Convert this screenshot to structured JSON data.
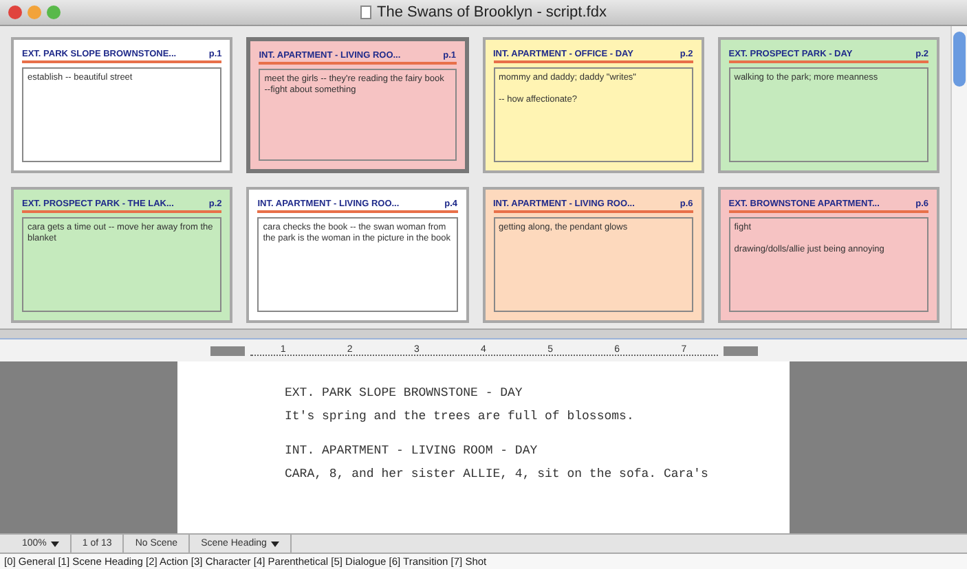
{
  "window": {
    "title": "The Swans of Brooklyn - script.fdx"
  },
  "cards": [
    {
      "heading": "EXT. PARK SLOPE BROWNSTONE...",
      "page": "p.1",
      "notes": "establish -- beautiful street",
      "color": "#ffffff",
      "selected": false
    },
    {
      "heading": "INT. APARTMENT - LIVING ROO...",
      "page": "p.1",
      "notes": "meet the girls -- they're reading the fairy book\n--fight about something",
      "color": "#f6c3c3",
      "selected": true
    },
    {
      "heading": "INT. APARTMENT - OFFICE - DAY",
      "page": "p.2",
      "notes": "mommy and daddy; daddy \"writes\"\n\n-- how affectionate?",
      "color": "#fff4b3",
      "selected": false
    },
    {
      "heading": "EXT. PROSPECT PARK - DAY",
      "page": "p.2",
      "notes": "walking to the park; more meanness",
      "color": "#c5eabd",
      "selected": false
    },
    {
      "heading": "EXT. PROSPECT PARK - THE LAK...",
      "page": "p.2",
      "notes": "cara gets a time out -- move her away from the blanket",
      "color": "#c5eabd",
      "selected": false
    },
    {
      "heading": "INT. APARTMENT - LIVING ROO...",
      "page": "p.4",
      "notes": "cara checks the book -- the swan woman from the park is the woman in the picture in the book",
      "color": "#ffffff",
      "selected": false
    },
    {
      "heading": "INT. APARTMENT - LIVING ROO...",
      "page": "p.6",
      "notes": "getting along, the pendant glows",
      "color": "#fdd9bd",
      "selected": false
    },
    {
      "heading": "EXT. BROWNSTONE APARTMENT...",
      "page": "p.6",
      "notes": "fight\n\ndrawing/dolls/allie just being annoying",
      "color": "#f6c3c3",
      "selected": false
    }
  ],
  "ruler": {
    "numbers": [
      "1",
      "2",
      "3",
      "4",
      "5",
      "6",
      "7"
    ]
  },
  "script": [
    {
      "kind": "heading",
      "text": "EXT. PARK SLOPE BROWNSTONE - DAY"
    },
    {
      "kind": "action",
      "text": "It's spring and the trees are full of blossoms."
    },
    {
      "kind": "heading",
      "text": "INT. APARTMENT - LIVING ROOM - DAY"
    },
    {
      "kind": "action",
      "text": "CARA, 8, and her sister ALLIE, 4, sit on the sofa.  Cara's"
    }
  ],
  "status_bar": {
    "zoom": "100%",
    "page": "1 of 13",
    "scene": "No Scene",
    "element": "Scene Heading"
  },
  "elements_hint": "[0] General [1] Scene Heading [2] Action [3] Character [4] Parenthetical [5] Dialogue [6] Transition [7] Shot"
}
